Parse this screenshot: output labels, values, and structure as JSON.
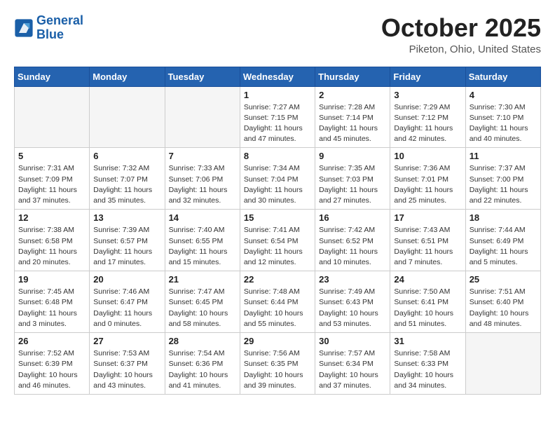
{
  "header": {
    "logo_line1": "General",
    "logo_line2": "Blue",
    "month": "October 2025",
    "location": "Piketon, Ohio, United States"
  },
  "weekdays": [
    "Sunday",
    "Monday",
    "Tuesday",
    "Wednesday",
    "Thursday",
    "Friday",
    "Saturday"
  ],
  "weeks": [
    [
      {
        "day": "",
        "info": ""
      },
      {
        "day": "",
        "info": ""
      },
      {
        "day": "",
        "info": ""
      },
      {
        "day": "1",
        "info": "Sunrise: 7:27 AM\nSunset: 7:15 PM\nDaylight: 11 hours\nand 47 minutes."
      },
      {
        "day": "2",
        "info": "Sunrise: 7:28 AM\nSunset: 7:14 PM\nDaylight: 11 hours\nand 45 minutes."
      },
      {
        "day": "3",
        "info": "Sunrise: 7:29 AM\nSunset: 7:12 PM\nDaylight: 11 hours\nand 42 minutes."
      },
      {
        "day": "4",
        "info": "Sunrise: 7:30 AM\nSunset: 7:10 PM\nDaylight: 11 hours\nand 40 minutes."
      }
    ],
    [
      {
        "day": "5",
        "info": "Sunrise: 7:31 AM\nSunset: 7:09 PM\nDaylight: 11 hours\nand 37 minutes."
      },
      {
        "day": "6",
        "info": "Sunrise: 7:32 AM\nSunset: 7:07 PM\nDaylight: 11 hours\nand 35 minutes."
      },
      {
        "day": "7",
        "info": "Sunrise: 7:33 AM\nSunset: 7:06 PM\nDaylight: 11 hours\nand 32 minutes."
      },
      {
        "day": "8",
        "info": "Sunrise: 7:34 AM\nSunset: 7:04 PM\nDaylight: 11 hours\nand 30 minutes."
      },
      {
        "day": "9",
        "info": "Sunrise: 7:35 AM\nSunset: 7:03 PM\nDaylight: 11 hours\nand 27 minutes."
      },
      {
        "day": "10",
        "info": "Sunrise: 7:36 AM\nSunset: 7:01 PM\nDaylight: 11 hours\nand 25 minutes."
      },
      {
        "day": "11",
        "info": "Sunrise: 7:37 AM\nSunset: 7:00 PM\nDaylight: 11 hours\nand 22 minutes."
      }
    ],
    [
      {
        "day": "12",
        "info": "Sunrise: 7:38 AM\nSunset: 6:58 PM\nDaylight: 11 hours\nand 20 minutes."
      },
      {
        "day": "13",
        "info": "Sunrise: 7:39 AM\nSunset: 6:57 PM\nDaylight: 11 hours\nand 17 minutes."
      },
      {
        "day": "14",
        "info": "Sunrise: 7:40 AM\nSunset: 6:55 PM\nDaylight: 11 hours\nand 15 minutes."
      },
      {
        "day": "15",
        "info": "Sunrise: 7:41 AM\nSunset: 6:54 PM\nDaylight: 11 hours\nand 12 minutes."
      },
      {
        "day": "16",
        "info": "Sunrise: 7:42 AM\nSunset: 6:52 PM\nDaylight: 11 hours\nand 10 minutes."
      },
      {
        "day": "17",
        "info": "Sunrise: 7:43 AM\nSunset: 6:51 PM\nDaylight: 11 hours\nand 7 minutes."
      },
      {
        "day": "18",
        "info": "Sunrise: 7:44 AM\nSunset: 6:49 PM\nDaylight: 11 hours\nand 5 minutes."
      }
    ],
    [
      {
        "day": "19",
        "info": "Sunrise: 7:45 AM\nSunset: 6:48 PM\nDaylight: 11 hours\nand 3 minutes."
      },
      {
        "day": "20",
        "info": "Sunrise: 7:46 AM\nSunset: 6:47 PM\nDaylight: 11 hours\nand 0 minutes."
      },
      {
        "day": "21",
        "info": "Sunrise: 7:47 AM\nSunset: 6:45 PM\nDaylight: 10 hours\nand 58 minutes."
      },
      {
        "day": "22",
        "info": "Sunrise: 7:48 AM\nSunset: 6:44 PM\nDaylight: 10 hours\nand 55 minutes."
      },
      {
        "day": "23",
        "info": "Sunrise: 7:49 AM\nSunset: 6:43 PM\nDaylight: 10 hours\nand 53 minutes."
      },
      {
        "day": "24",
        "info": "Sunrise: 7:50 AM\nSunset: 6:41 PM\nDaylight: 10 hours\nand 51 minutes."
      },
      {
        "day": "25",
        "info": "Sunrise: 7:51 AM\nSunset: 6:40 PM\nDaylight: 10 hours\nand 48 minutes."
      }
    ],
    [
      {
        "day": "26",
        "info": "Sunrise: 7:52 AM\nSunset: 6:39 PM\nDaylight: 10 hours\nand 46 minutes."
      },
      {
        "day": "27",
        "info": "Sunrise: 7:53 AM\nSunset: 6:37 PM\nDaylight: 10 hours\nand 43 minutes."
      },
      {
        "day": "28",
        "info": "Sunrise: 7:54 AM\nSunset: 6:36 PM\nDaylight: 10 hours\nand 41 minutes."
      },
      {
        "day": "29",
        "info": "Sunrise: 7:56 AM\nSunset: 6:35 PM\nDaylight: 10 hours\nand 39 minutes."
      },
      {
        "day": "30",
        "info": "Sunrise: 7:57 AM\nSunset: 6:34 PM\nDaylight: 10 hours\nand 37 minutes."
      },
      {
        "day": "31",
        "info": "Sunrise: 7:58 AM\nSunset: 6:33 PM\nDaylight: 10 hours\nand 34 minutes."
      },
      {
        "day": "",
        "info": ""
      }
    ]
  ]
}
